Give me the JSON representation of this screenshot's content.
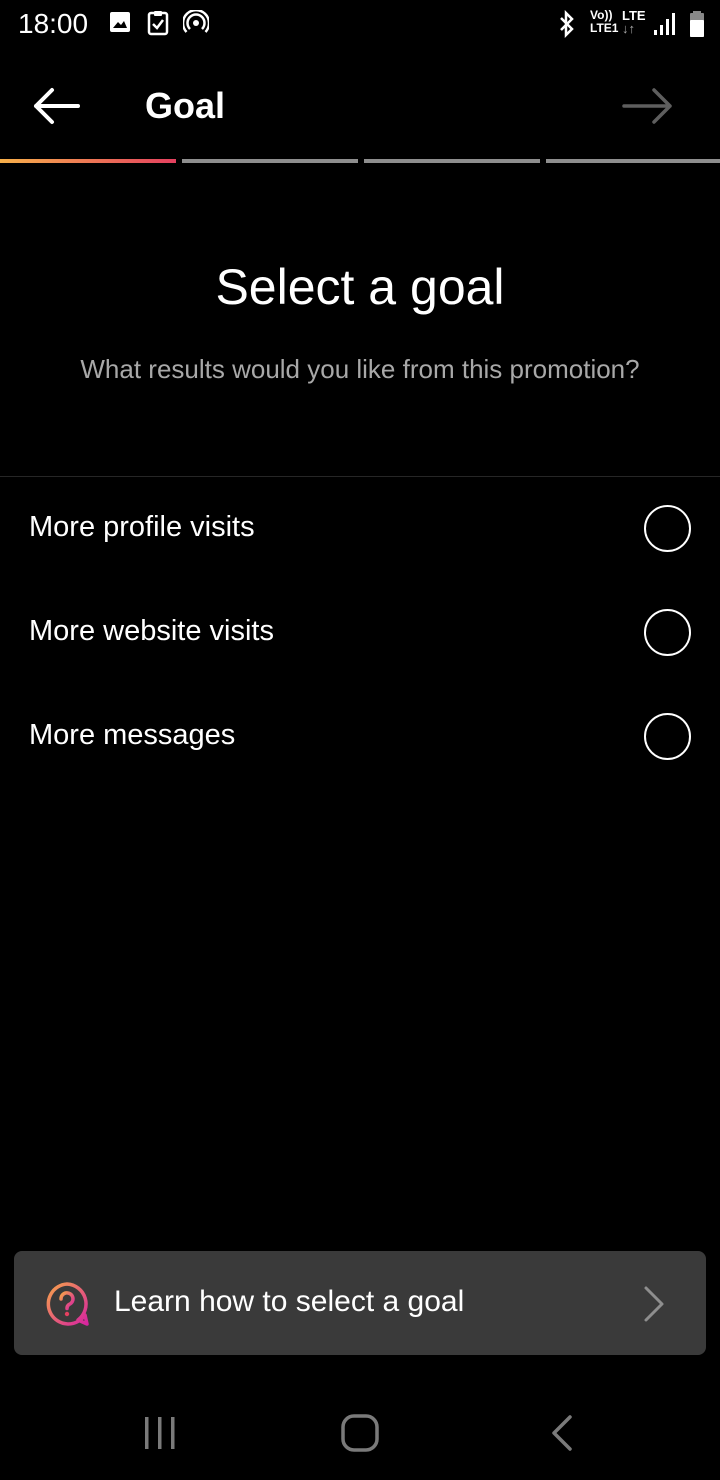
{
  "status_bar": {
    "time": "18:00",
    "net_top": "Vo))",
    "net_bottom": "LTE1",
    "lte_top": "LTE",
    "lte_bottom": "↓↑",
    "icons": [
      "image-icon",
      "clipboard-check-icon",
      "hotspot-icon",
      "bluetooth-icon",
      "signal-icon",
      "battery-icon"
    ]
  },
  "header": {
    "title": "Goal",
    "back_icon": "arrow-left-icon",
    "next_icon": "arrow-right-icon"
  },
  "progress": {
    "total_steps": 4,
    "current_step": 1,
    "active_gradient": [
      "#f7b04a",
      "#e4405f"
    ],
    "inactive_color": "#8e8e8e"
  },
  "main": {
    "title": "Select a goal",
    "subtitle": "What results would you like from this promotion?"
  },
  "options": [
    {
      "label": "More profile visits",
      "selected": false
    },
    {
      "label": "More website visits",
      "selected": false
    },
    {
      "label": "More messages",
      "selected": false
    }
  ],
  "learn_card": {
    "label": "Learn how to select a goal",
    "icon": "question-bubble-icon",
    "chevron": "chevron-right-icon"
  },
  "nav_bar": {
    "icons": [
      "recents-icon",
      "home-icon",
      "back-icon"
    ]
  },
  "colors": {
    "background": "#000000",
    "text": "#ffffff",
    "secondary_text": "#a8a8a8",
    "card": "#3a3a3a"
  }
}
